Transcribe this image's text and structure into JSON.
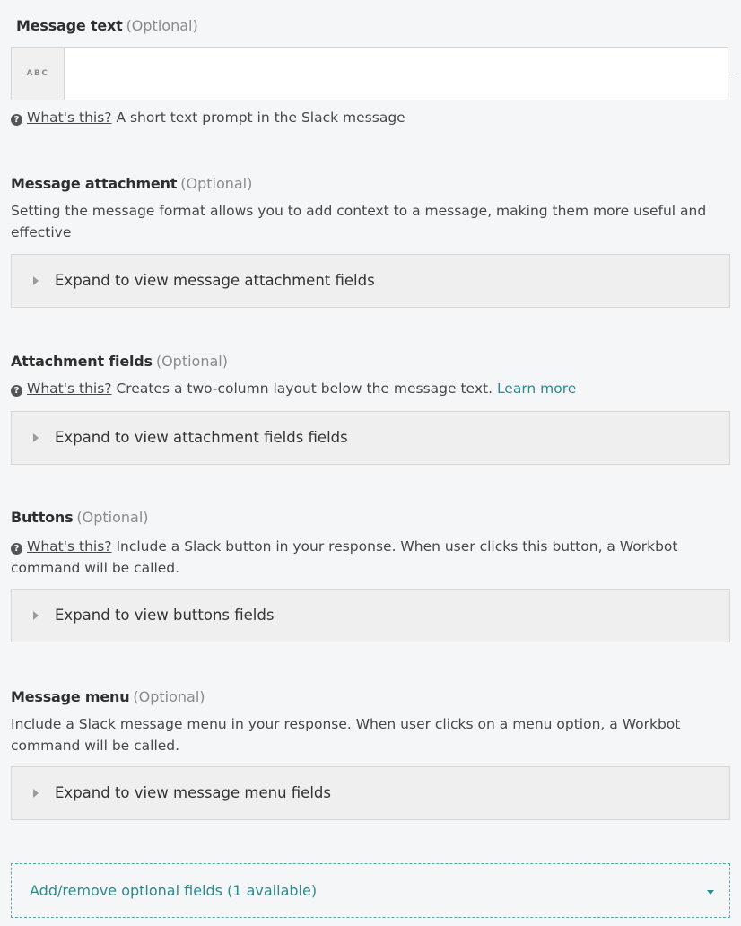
{
  "message_text": {
    "label": "Message text",
    "optional": "(Optional)",
    "badge": "ABC",
    "value": "",
    "help_link": "What's this?",
    "help_text": "A short text prompt in the Slack message"
  },
  "message_attachment": {
    "label": "Message attachment",
    "optional": "(Optional)",
    "description": "Setting the message format allows you to add context to a message, making them more useful and effective",
    "expander": "Expand to view message attachment fields"
  },
  "attachment_fields": {
    "label": "Attachment fields",
    "optional": "(Optional)",
    "help_link": "What's this?",
    "help_text": "Creates a two-column layout below the message text.",
    "learn_more": "Learn more",
    "expander": "Expand to view attachment fields fields"
  },
  "buttons": {
    "label": "Buttons",
    "optional": "(Optional)",
    "help_link": "What's this?",
    "help_text": "Include a Slack button in your response. When user clicks this button, a Workbot command will be called.",
    "expander": "Expand to view buttons fields"
  },
  "message_menu": {
    "label": "Message menu",
    "optional": "(Optional)",
    "description": "Include a Slack message menu in your response. When user clicks on a menu option, a Workbot command will be called.",
    "expander": "Expand to view message menu fields"
  },
  "add_remove": {
    "label": "Add/remove optional fields (1 available)"
  },
  "colors": {
    "accent": "#2b8a90",
    "background": "#f5f6f8",
    "panel": "#efefef"
  }
}
